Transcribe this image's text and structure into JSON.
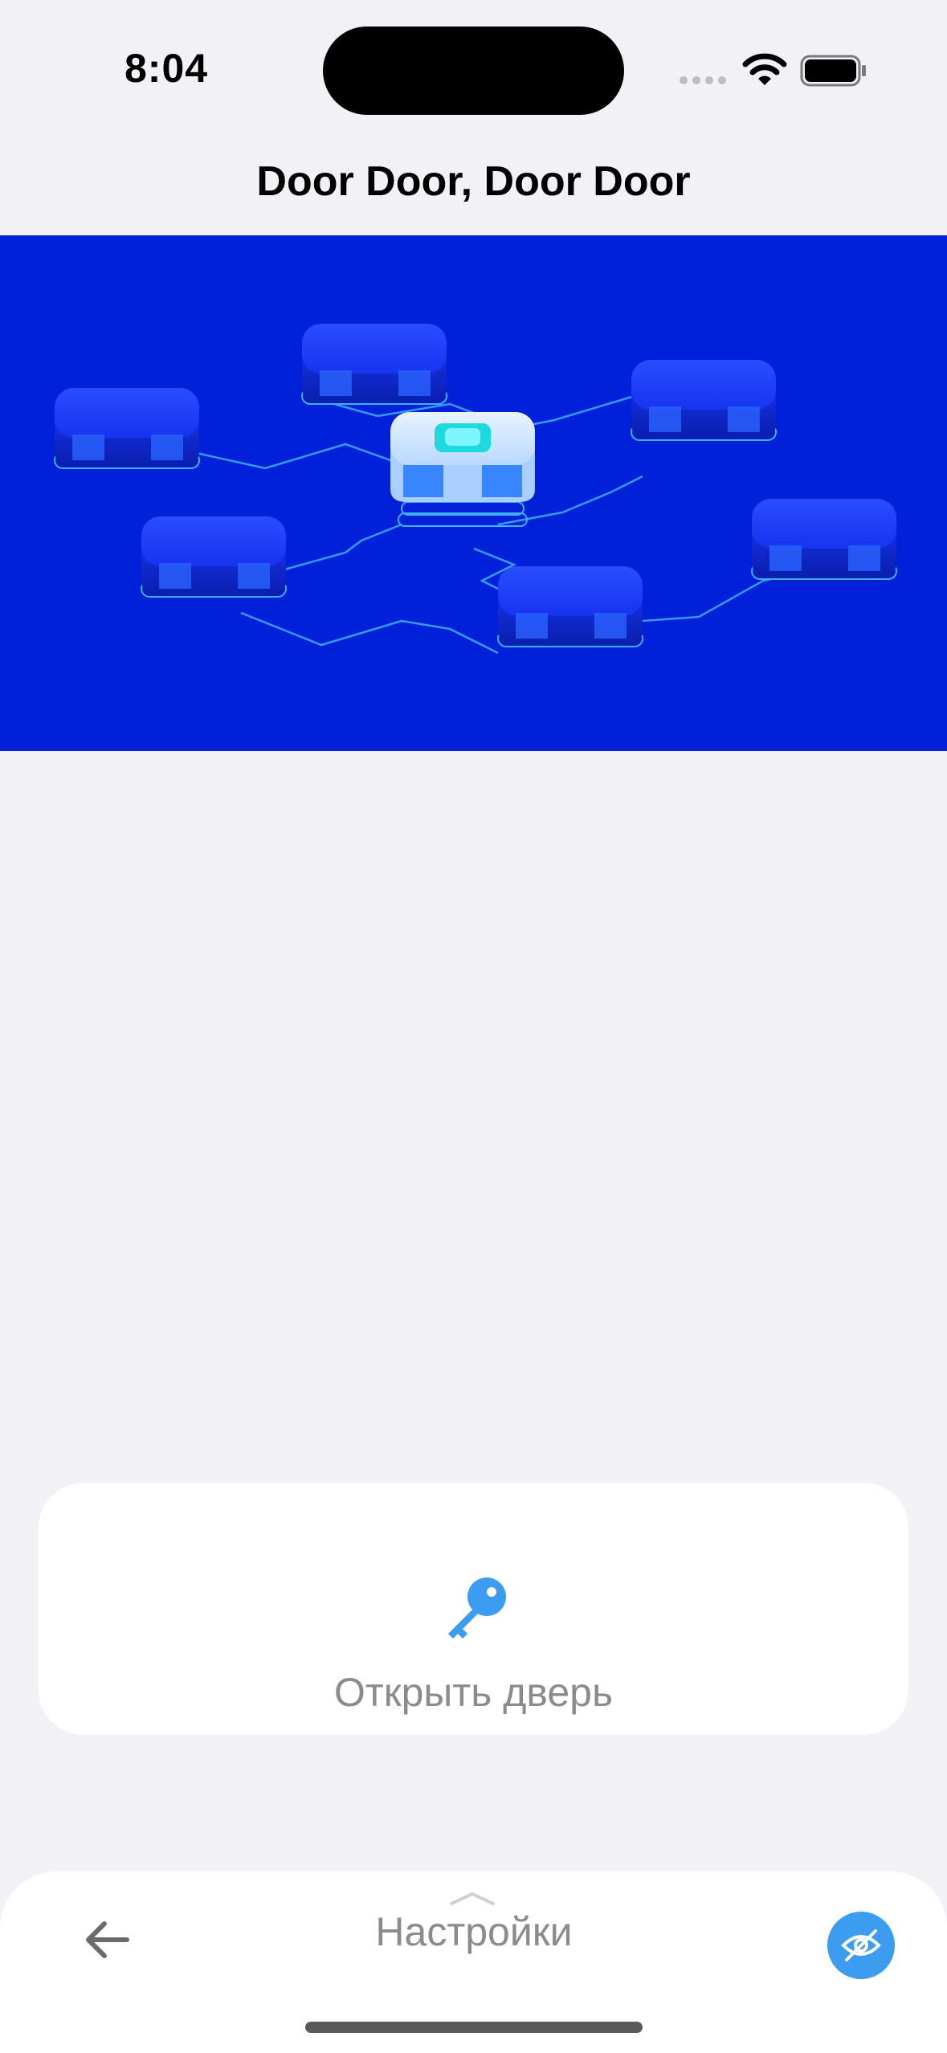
{
  "status_bar": {
    "time": "8:04"
  },
  "navigation": {
    "title": "Door Door, Door Door"
  },
  "hero": {
    "icon": "network-servers-illustration",
    "background_color": "#0021d9"
  },
  "open_door_card": {
    "icon": "key-icon",
    "label": "Открыть дверь",
    "accent_color": "#3b9cf0"
  },
  "bottom_bar": {
    "back_icon": "arrow-left-icon",
    "settings_label": "Настройки",
    "hide_icon": "eye-slash-icon"
  }
}
